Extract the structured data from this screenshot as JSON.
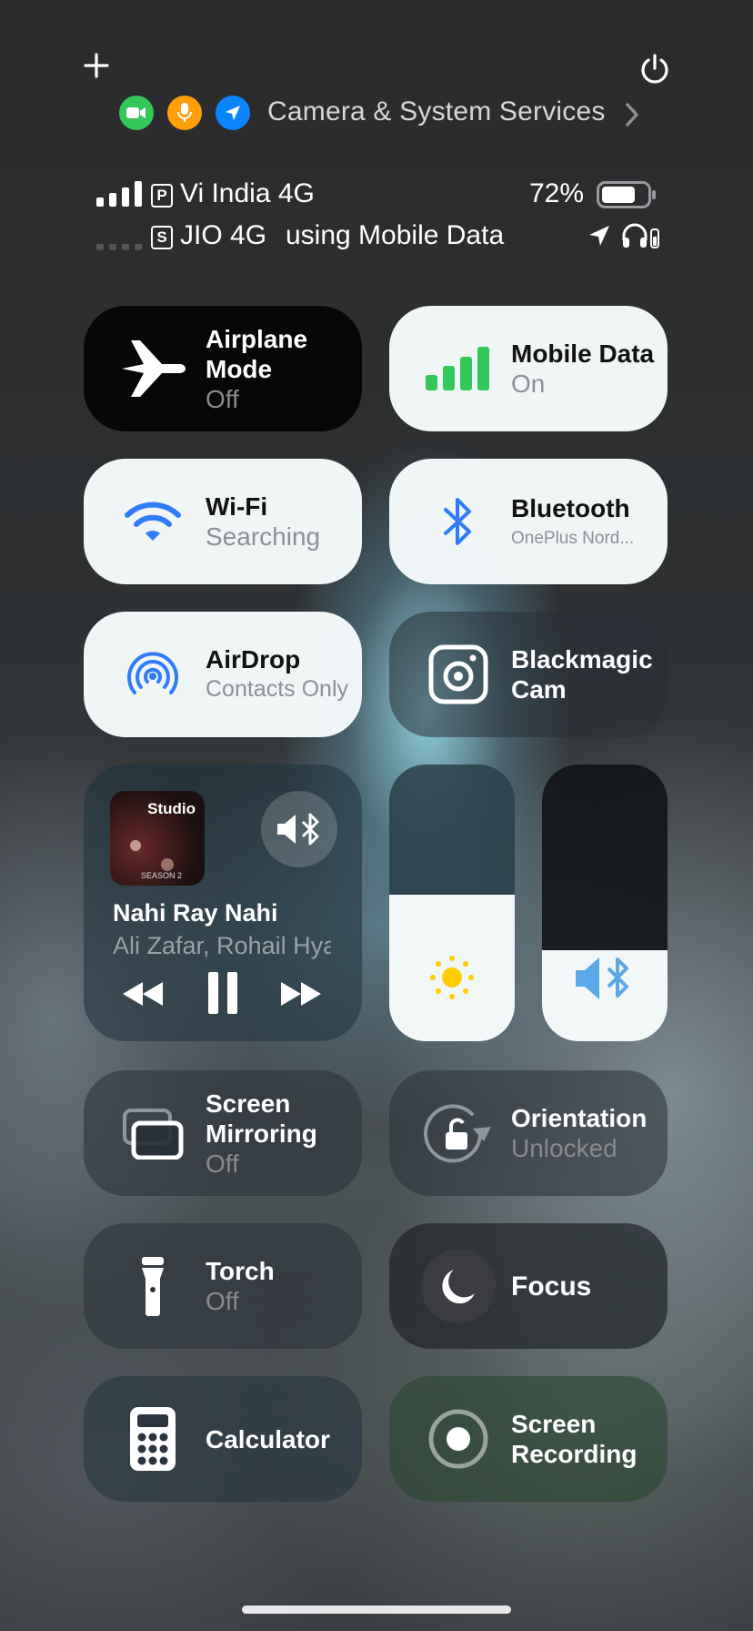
{
  "privacy": {
    "label": "Camera & System Services",
    "indicators": [
      {
        "icon": "video-camera-icon",
        "color": "#34c759"
      },
      {
        "icon": "microphone-icon",
        "color": "#ff9f0a"
      },
      {
        "icon": "location-arrow-icon",
        "color": "#0a84ff"
      }
    ]
  },
  "status": {
    "sim1": {
      "badge": "P",
      "carrier": "Vi India 4G"
    },
    "sim2": {
      "badge": "S",
      "carrier": "JIO 4G",
      "note": "using Mobile Data"
    },
    "battery": "72%"
  },
  "tiles": {
    "airplane": {
      "title": "Airplane Mode",
      "state": "Off"
    },
    "mobile_data": {
      "title": "Mobile Data",
      "state": "On"
    },
    "wifi": {
      "title": "Wi-Fi",
      "state": "Searching"
    },
    "bluetooth": {
      "title": "Bluetooth",
      "state": "OnePlus Nord..."
    },
    "airdrop": {
      "title": "AirDrop",
      "state": "Contacts Only"
    },
    "blackmagic": {
      "title": "Blackmagic Cam"
    },
    "screen_mirroring": {
      "title": "Screen Mirroring",
      "state": "Off"
    },
    "orientation": {
      "title": "Orientation",
      "state": "Unlocked"
    },
    "torch": {
      "title": "Torch",
      "state": "Off"
    },
    "focus": {
      "title": "Focus"
    },
    "calculator": {
      "title": "Calculator"
    },
    "screen_recording": {
      "title": "Screen Recording"
    }
  },
  "media": {
    "album_art_text": "Studio",
    "album_season": "SEASON 2",
    "track": "Nahi Ray Nahi",
    "artist": "Ali Zafar, Rohail Hyatt"
  },
  "sliders": {
    "brightness_level": 0.53,
    "volume_level": 0.33
  },
  "colors": {
    "accent_blue": "#2f7cf6",
    "signal_green": "#34c759",
    "sun_yellow": "#ffcc00"
  }
}
